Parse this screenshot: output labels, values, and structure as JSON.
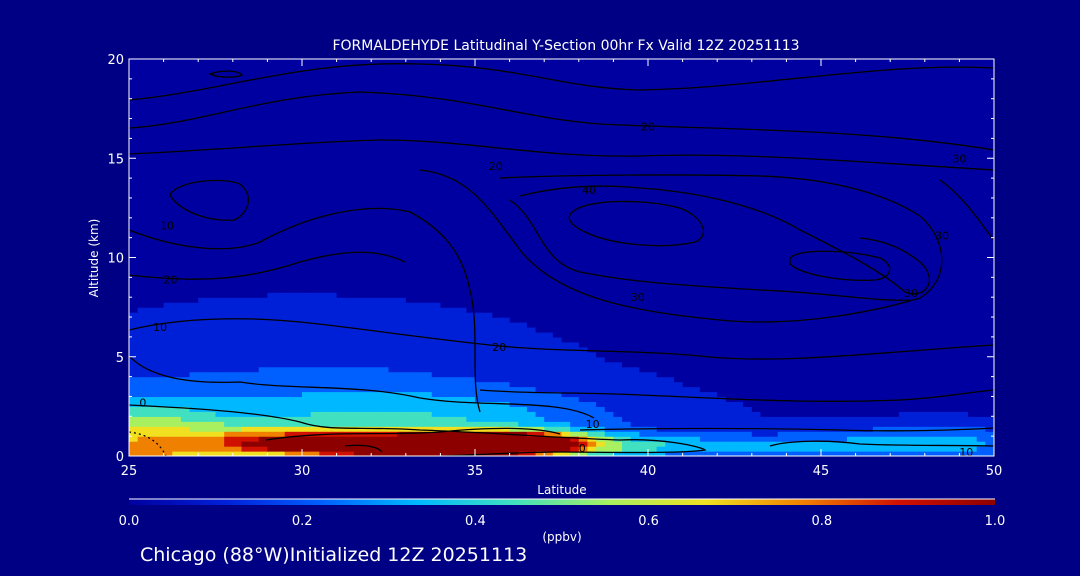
{
  "chart_data": {
    "type": "heatmap",
    "title": "FORMALDEHYDE Latitudinal Y-Section 00hr  Fx Valid 12Z 20251113",
    "xlabel": "Latitude",
    "ylabel": "Altitude (km)",
    "xlim": [
      25,
      50
    ],
    "ylim": [
      0,
      20
    ],
    "x_ticks": [
      "25",
      "30",
      "35",
      "40",
      "45",
      "50"
    ],
    "y_ticks": [
      "0",
      "5",
      "10",
      "15",
      "20"
    ],
    "colorbar": {
      "label": "(ppbv)",
      "range": [
        0.0,
        1.0
      ],
      "ticks": [
        "0.0",
        "0.2",
        "0.4",
        "0.6",
        "0.8",
        "1.0"
      ],
      "colors": [
        "#0000a0",
        "#0020d8",
        "#0060ff",
        "#00b8ff",
        "#40e0c0",
        "#a8f060",
        "#f0e020",
        "#f08000",
        "#d01000",
        "#8c0000"
      ]
    },
    "contour_labels": [
      {
        "text": "10",
        "lat": 26.1,
        "alt": 11.6
      },
      {
        "text": "20",
        "lat": 26.2,
        "alt": 8.9
      },
      {
        "text": "10",
        "lat": 25.9,
        "alt": 6.5
      },
      {
        "text": "0",
        "lat": 25.4,
        "alt": 2.7
      },
      {
        "text": "20",
        "lat": 35.6,
        "alt": 14.6
      },
      {
        "text": "20",
        "lat": 40.0,
        "alt": 16.6
      },
      {
        "text": "40",
        "lat": 38.3,
        "alt": 13.4
      },
      {
        "text": "30",
        "lat": 39.7,
        "alt": 8.0
      },
      {
        "text": "20",
        "lat": 35.7,
        "alt": 5.5
      },
      {
        "text": "10",
        "lat": 38.4,
        "alt": 1.6
      },
      {
        "text": "0",
        "lat": 38.1,
        "alt": 0.4
      },
      {
        "text": "30",
        "lat": 49.0,
        "alt": 15.0
      },
      {
        "text": "30",
        "lat": 48.5,
        "alt": 11.1
      },
      {
        "text": "30",
        "lat": 47.6,
        "alt": 8.2
      },
      {
        "text": "10",
        "lat": 49.2,
        "alt": 0.2
      }
    ],
    "field": {
      "base_level": 0.08,
      "blobs": [
        {
          "lat": 33.3,
          "alt": 0.55,
          "value": 1.2,
          "sx": 3.0,
          "sy": 0.45
        },
        {
          "lat": 36.3,
          "alt": 0.7,
          "value": 0.55,
          "sx": 1.2,
          "sy": 0.4
        },
        {
          "lat": 25.3,
          "alt": 0.2,
          "value": 0.55,
          "sx": 1.6,
          "sy": 1.6
        },
        {
          "lat": 28.8,
          "alt": 0.8,
          "value": 0.3,
          "sx": 1.4,
          "sy": 0.6
        },
        {
          "lat": 33.0,
          "alt": 1.8,
          "value": 0.26,
          "sx": 4.5,
          "sy": 1.2
        },
        {
          "lat": 42.0,
          "alt": 0.5,
          "value": 0.22,
          "sx": 4.0,
          "sy": 0.45
        },
        {
          "lat": 48.5,
          "alt": 0.7,
          "value": 0.22,
          "sx": 2.5,
          "sy": 0.7
        },
        {
          "lat": 30.0,
          "alt": 4.0,
          "value": 0.12,
          "sx": 5.5,
          "sy": 3.0
        }
      ]
    }
  },
  "footer": {
    "location_text": "Chicago (88°W)Initialized 12Z 20251113"
  }
}
